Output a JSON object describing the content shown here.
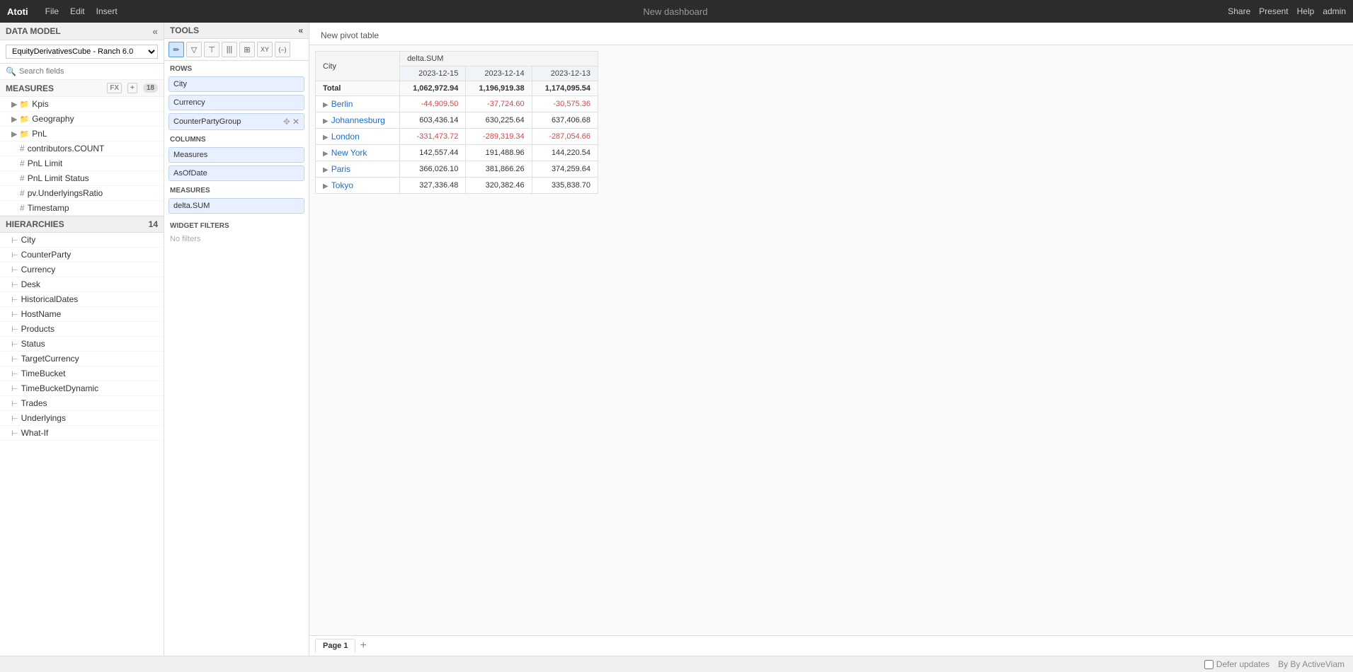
{
  "app": {
    "logo": "Atoti",
    "nav": [
      "File",
      "Edit",
      "Insert"
    ],
    "title": "New dashboard",
    "nav_right": [
      "Share",
      "Present",
      "Help",
      "admin"
    ]
  },
  "left_panel": {
    "header": "DATA MODEL",
    "model_selector": "EquityDerivativesCube - Ranch 6.0",
    "search_placeholder": "Search fields",
    "measures_header": "MEASURES",
    "measures_badge": "18",
    "measures_items": [
      {
        "label": "Kpis",
        "type": "folder"
      },
      {
        "label": "Geography",
        "type": "folder"
      },
      {
        "label": "PnL",
        "type": "folder"
      },
      {
        "label": "contributors.COUNT",
        "type": "hash"
      },
      {
        "label": "PnL Limit",
        "type": "hash"
      },
      {
        "label": "PnL Limit Status",
        "type": "hash"
      },
      {
        "label": "pv.UnderlyingsRatio",
        "type": "hash"
      },
      {
        "label": "Timestamp",
        "type": "hash"
      }
    ],
    "hierarchies_header": "HIERARCHIES",
    "hierarchies_badge": "14",
    "hierarchies_items": [
      "City",
      "CounterParty",
      "Currency",
      "Desk",
      "HistoricalDates",
      "HostName",
      "Products",
      "Status",
      "TargetCurrency",
      "TimeBucket",
      "TimeBucketDynamic",
      "Trades",
      "Underlyings",
      "What-If"
    ]
  },
  "tools_panel": {
    "header": "TOOLS",
    "toolbar_buttons": [
      {
        "icon": "✏",
        "label": "edit"
      },
      {
        "icon": "▽",
        "label": "filter"
      },
      {
        "icon": "⊤",
        "label": "sort"
      },
      {
        "icon": "≡|",
        "label": "columns"
      },
      {
        "icon": "⊞",
        "label": "grid"
      },
      {
        "icon": "XY",
        "label": "xy"
      },
      {
        "icon": "(–)",
        "label": "conditional"
      }
    ],
    "rows_label": "Rows",
    "rows_items": [
      "City",
      "Currency",
      "CounterPartyGroup"
    ],
    "columns_label": "Columns",
    "columns_items": [
      "Measures",
      "AsOfDate"
    ],
    "measures_label": "Measures",
    "measures_items": [
      "delta.SUM"
    ],
    "widget_filters_label": "Widget filters",
    "no_filters": "No filters"
  },
  "pivot": {
    "title": "New pivot table",
    "col_city": "City",
    "col_measure": "delta.SUM",
    "dates": [
      "2023-12-15",
      "2023-12-14",
      "2023-12-13"
    ],
    "total_row": {
      "label": "Total",
      "values": [
        "1,062,972.94",
        "1,196,919.38",
        "1,174,095.54"
      ]
    },
    "rows": [
      {
        "city": "Berlin",
        "values": [
          "-44,909.50",
          "-37,724.60",
          "-30,575.36"
        ],
        "negative": [
          true,
          true,
          true
        ]
      },
      {
        "city": "Johannesburg",
        "values": [
          "603,436.14",
          "630,225.64",
          "637,406.68"
        ],
        "negative": [
          false,
          false,
          false
        ]
      },
      {
        "city": "London",
        "values": [
          "-331,473.72",
          "-289,319.34",
          "-287,054.66"
        ],
        "negative": [
          true,
          true,
          true
        ]
      },
      {
        "city": "New York",
        "values": [
          "142,557.44",
          "191,488.96",
          "144,220.54"
        ],
        "negative": [
          false,
          false,
          false
        ]
      },
      {
        "city": "Paris",
        "values": [
          "366,026.10",
          "381,866.26",
          "374,259.64"
        ],
        "negative": [
          false,
          false,
          false
        ]
      },
      {
        "city": "Tokyo",
        "values": [
          "327,336.48",
          "320,382.46",
          "335,838.70"
        ],
        "negative": [
          false,
          false,
          false
        ]
      }
    ]
  },
  "page_tabs": [
    {
      "label": "Page 1",
      "active": true
    }
  ],
  "bottom_bar": {
    "defer_label": "Defer updates",
    "by_label": "By ActiveViam"
  }
}
